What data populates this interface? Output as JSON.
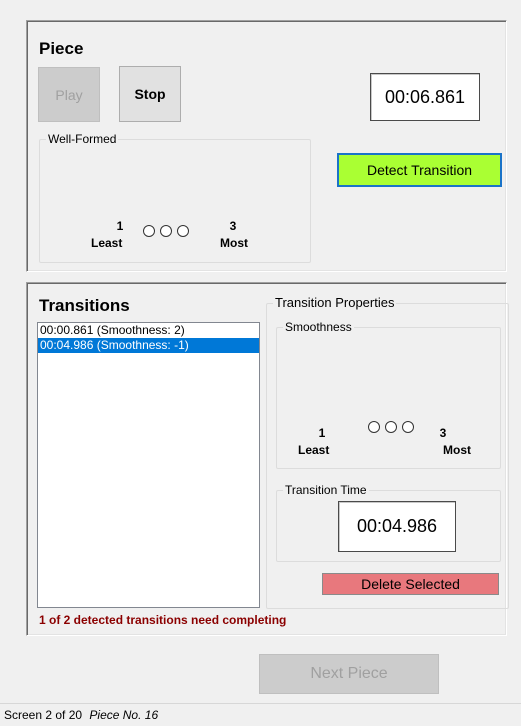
{
  "piece": {
    "title": "Piece",
    "play_label": "Play",
    "stop_label": "Stop",
    "time": "00:06.861",
    "wellformed_label": "Well-Formed",
    "detect_label": "Detect Transition",
    "scale": {
      "low_num": "1",
      "low_label": "Least",
      "high_num": "3",
      "high_label": "Most"
    }
  },
  "transitions": {
    "title": "Transitions",
    "items": [
      {
        "text": "00:00.861 (Smoothness: 2)",
        "selected": false
      },
      {
        "text": "00:04.986 (Smoothness: -1)",
        "selected": true
      }
    ],
    "properties_label": "Transition Properties",
    "smoothness_label": "Smoothness",
    "scale": {
      "low_num": "1",
      "low_label": "Least",
      "high_num": "3",
      "high_label": "Most"
    },
    "time_label": "Transition Time",
    "time": "00:04.986",
    "delete_label": "Delete Selected",
    "warning": "1 of 2 detected transitions need completing"
  },
  "next_label": "Next Piece",
  "status": {
    "screen": "Screen 2 of 20",
    "piece": "Piece No. 16"
  },
  "colors": {
    "detect_bg": "#aaff33",
    "delete_bg": "#e8787d",
    "warning": "#8b0000",
    "selection": "#0078d7"
  }
}
